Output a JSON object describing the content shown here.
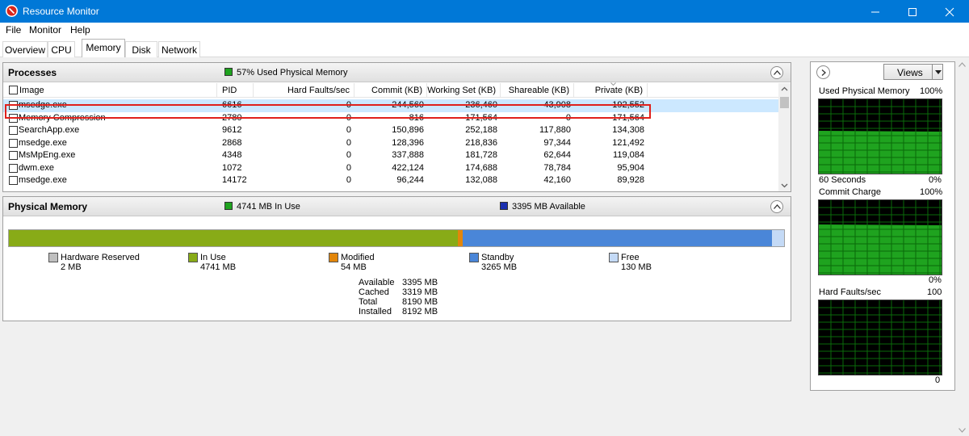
{
  "window": {
    "title": "Resource Monitor"
  },
  "menu": [
    "File",
    "Monitor",
    "Help"
  ],
  "tabs": [
    "Overview",
    "CPU",
    "Memory",
    "Disk",
    "Network"
  ],
  "processes": {
    "title": "Processes",
    "stat": "57% Used Physical Memory",
    "columns": [
      "Image",
      "PID",
      "Hard Faults/sec",
      "Commit (KB)",
      "Working Set (KB)",
      "Shareable (KB)",
      "Private (KB)"
    ],
    "rows": [
      {
        "image": "msedge.exe",
        "pid": "6616",
        "hard_faults": "0",
        "commit": "244,560",
        "working_set": "236,460",
        "shareable": "43,908",
        "private": "192,552",
        "selected": true
      },
      {
        "image": "Memory Compression",
        "pid": "2780",
        "hard_faults": "0",
        "commit": "816",
        "working_set": "171,564",
        "shareable": "0",
        "private": "171,564"
      },
      {
        "image": "SearchApp.exe",
        "pid": "9612",
        "hard_faults": "0",
        "commit": "150,896",
        "working_set": "252,188",
        "shareable": "117,880",
        "private": "134,308"
      },
      {
        "image": "msedge.exe",
        "pid": "2868",
        "hard_faults": "0",
        "commit": "128,396",
        "working_set": "218,836",
        "shareable": "97,344",
        "private": "121,492"
      },
      {
        "image": "MsMpEng.exe",
        "pid": "4348",
        "hard_faults": "0",
        "commit": "337,888",
        "working_set": "181,728",
        "shareable": "62,644",
        "private": "119,084"
      },
      {
        "image": "dwm.exe",
        "pid": "1072",
        "hard_faults": "0",
        "commit": "422,124",
        "working_set": "174,688",
        "shareable": "78,784",
        "private": "95,904"
      },
      {
        "image": "msedge.exe",
        "pid": "14172",
        "hard_faults": "0",
        "commit": "96,244",
        "working_set": "132,088",
        "shareable": "42,160",
        "private": "89,928"
      }
    ]
  },
  "physical_memory": {
    "title": "Physical Memory",
    "in_use_stat": "4741 MB In Use",
    "available_stat": "3395 MB Available",
    "bar_mb": {
      "hardware_reserved": 2,
      "in_use": 4741,
      "modified": 54,
      "standby": 3265,
      "free": 130
    },
    "legend": [
      {
        "label": "Hardware Reserved",
        "value": "2 MB",
        "color": "#bfbfbf"
      },
      {
        "label": "In Use",
        "value": "4741 MB",
        "color": "#88ab17"
      },
      {
        "label": "Modified",
        "value": "54 MB",
        "color": "#e2860b"
      },
      {
        "label": "Standby",
        "value": "3265 MB",
        "color": "#4a86d8"
      },
      {
        "label": "Free",
        "value": "130 MB",
        "color": "#c4daf6"
      }
    ],
    "stats": [
      {
        "label": "Available",
        "value": "3395 MB"
      },
      {
        "label": "Cached",
        "value": "3319 MB"
      },
      {
        "label": "Total",
        "value": "8190 MB"
      },
      {
        "label": "Installed",
        "value": "8192 MB"
      }
    ]
  },
  "side": {
    "views_label": "Views",
    "graphs": [
      {
        "title": "Used Physical Memory",
        "max": "100%",
        "min": "0%",
        "time": "60 Seconds"
      },
      {
        "title": "Commit Charge",
        "max": "100%",
        "min": "0%"
      },
      {
        "title": "Hard Faults/sec",
        "max": "100",
        "min": "0"
      }
    ]
  },
  "colors": {
    "titlebar": "#0078d7",
    "selection": "#cce8ff",
    "highlight": "#e0201b",
    "graph_fill": "#1fa31f",
    "graph_grid": "#008000"
  }
}
